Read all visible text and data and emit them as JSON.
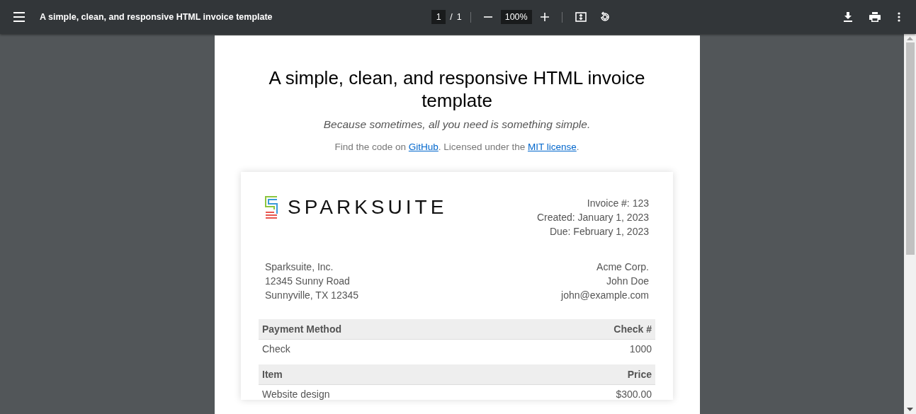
{
  "toolbar": {
    "title": "A simple, clean, and responsive HTML invoice template",
    "page": "1",
    "page_count": "1",
    "separator": "/",
    "zoom": "100%"
  },
  "document": {
    "title": "A simple, clean, and responsive HTML invoice template",
    "tagline": "Because sometimes, all you need is something simple.",
    "credits": {
      "before": "Find the code on ",
      "link1": "GitHub",
      "middle": ". Licensed under the ",
      "link2": "MIT license",
      "after": "."
    },
    "invoice": {
      "logo": "SPARKSUITE",
      "details": [
        "Invoice #: 123",
        "Created: January 1, 2023",
        "Due: February 1, 2023"
      ],
      "from": [
        "Sparksuite, Inc.",
        "12345 Sunny Road",
        "Sunnyville, TX 12345"
      ],
      "to": [
        "Acme Corp.",
        "John Doe",
        "john@example.com"
      ],
      "sections": [
        {
          "heading": [
            "Payment Method",
            "Check #"
          ],
          "rows": [
            [
              "Check",
              "1000"
            ]
          ]
        },
        {
          "heading": [
            "Item",
            "Price"
          ],
          "rows": [
            [
              "Website design",
              "$300.00"
            ]
          ]
        }
      ]
    }
  }
}
